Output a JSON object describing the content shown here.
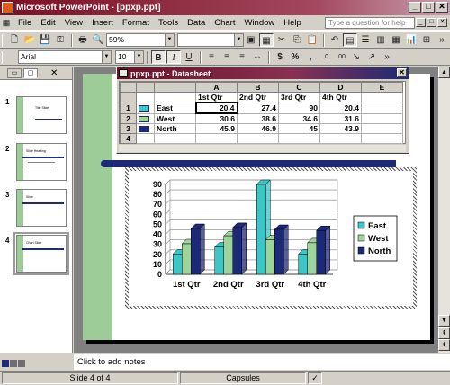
{
  "window": {
    "title": "Microsoft PowerPoint - [ppxp.ppt]",
    "min": "_",
    "max": "□",
    "close": "✕"
  },
  "menu": {
    "items": [
      {
        "label": "File"
      },
      {
        "label": "Edit"
      },
      {
        "label": "View"
      },
      {
        "label": "Insert"
      },
      {
        "label": "Format"
      },
      {
        "label": "Tools"
      },
      {
        "label": "Data"
      },
      {
        "label": "Chart"
      },
      {
        "label": "Window"
      },
      {
        "label": "Help"
      }
    ],
    "help_placeholder": "Type a question for help"
  },
  "toolbar": {
    "zoom": "59%",
    "font": "Arial",
    "font_size": "10"
  },
  "slides_pane": {
    "slides": [
      {
        "number": "1"
      },
      {
        "number": "2"
      },
      {
        "number": "3"
      },
      {
        "number": "4"
      }
    ]
  },
  "datasheet": {
    "title": "ppxp.ppt - Datasheet",
    "columns": [
      "A",
      "B",
      "C",
      "D",
      "E"
    ],
    "header_row": [
      "1st Qtr",
      "2nd Qtr",
      "3rd Qtr",
      "4th Qtr",
      ""
    ],
    "rows": [
      {
        "num": "1",
        "label": "East",
        "values": [
          "20.4",
          "27.4",
          "90",
          "20.4"
        ]
      },
      {
        "num": "2",
        "label": "West",
        "values": [
          "30.6",
          "38.6",
          "34.6",
          "31.6"
        ]
      },
      {
        "num": "3",
        "label": "North",
        "values": [
          "45.9",
          "46.9",
          "45",
          "43.9"
        ]
      },
      {
        "num": "4",
        "label": "",
        "values": [
          "",
          "",
          "",
          ""
        ]
      }
    ]
  },
  "chart_data": {
    "type": "bar",
    "categories": [
      "1st Qtr",
      "2nd Qtr",
      "3rd Qtr",
      "4th Qtr"
    ],
    "series": [
      {
        "name": "East",
        "values": [
          20.4,
          27.4,
          90,
          20.4
        ],
        "color": "#3cc6c8"
      },
      {
        "name": "West",
        "values": [
          30.6,
          38.6,
          34.6,
          31.6
        ],
        "color": "#9ed39a"
      },
      {
        "name": "North",
        "values": [
          45.9,
          46.9,
          45,
          43.9
        ],
        "color": "#1c2878"
      }
    ],
    "yticks": [
      "0",
      "10",
      "20",
      "30",
      "40",
      "50",
      "60",
      "70",
      "80",
      "90"
    ],
    "ylim": [
      0,
      90
    ],
    "legend": "right",
    "grid": true
  },
  "notes": {
    "placeholder": "Click to add notes"
  },
  "status": {
    "slide": "Slide 4 of 4",
    "design": "Capsules"
  },
  "colors": {
    "title_bar": "#7a0f22",
    "slide_green": "#9dcc98",
    "slide_navy": "#1c2a78"
  }
}
